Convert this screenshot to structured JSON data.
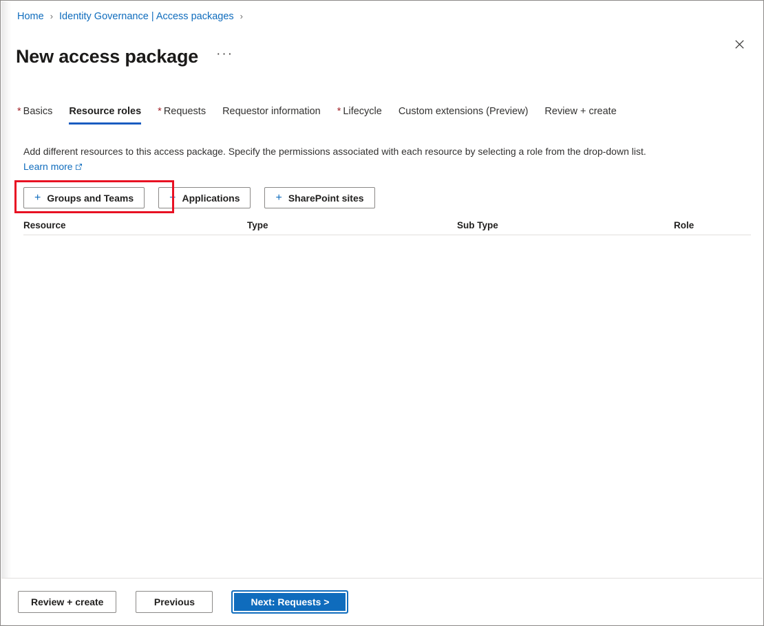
{
  "breadcrumb": {
    "items": [
      {
        "label": "Home",
        "link": true
      },
      {
        "label": "Identity Governance | Access packages",
        "link": true
      }
    ],
    "separator": "›"
  },
  "header": {
    "title": "New access package",
    "ellipsis": "···",
    "close_label": "Close",
    "close_icon": "close-icon"
  },
  "tabs": [
    {
      "label": "Basics",
      "required": true,
      "active": false,
      "required_mark": "*"
    },
    {
      "label": "Resource roles",
      "required": false,
      "active": true,
      "required_mark": "*"
    },
    {
      "label": "Requests",
      "required": true,
      "active": false,
      "required_mark": "*"
    },
    {
      "label": "Requestor information",
      "required": false,
      "active": false,
      "required_mark": "*"
    },
    {
      "label": "Lifecycle",
      "required": true,
      "active": false,
      "required_mark": "*"
    },
    {
      "label": "Custom extensions (Preview)",
      "required": false,
      "active": false,
      "required_mark": "*"
    },
    {
      "label": "Review + create",
      "required": false,
      "active": false,
      "required_mark": "*"
    }
  ],
  "description": {
    "text": "Add different resources to this access package. Specify the permissions associated with each resource by selecting a role from the drop-down list.",
    "link_label": "Learn more",
    "link_icon": "external-link-icon"
  },
  "resource_buttons": [
    {
      "label": "Groups and Teams",
      "icon": "plus-icon",
      "highlighted": true
    },
    {
      "label": "Applications",
      "icon": "plus-icon",
      "highlighted": false
    },
    {
      "label": "SharePoint sites",
      "icon": "plus-icon",
      "highlighted": false
    }
  ],
  "table": {
    "columns": [
      {
        "key": "resource",
        "label": "Resource"
      },
      {
        "key": "type",
        "label": "Type"
      },
      {
        "key": "sub_type",
        "label": "Sub Type"
      },
      {
        "key": "role",
        "label": "Role"
      }
    ],
    "rows": []
  },
  "footer": {
    "buttons": [
      {
        "label": "Review + create",
        "primary": false
      },
      {
        "label": "Previous",
        "primary": false
      },
      {
        "label": "Next: Requests >",
        "primary": true
      }
    ]
  },
  "colors": {
    "link_blue": "#0f6cbd",
    "tab_underline_blue": "#1a5cc0",
    "primary_button_blue": "#0f6cbd",
    "required_asterisk_red": "#a4262c",
    "annotation_red": "#e81123",
    "text_primary": "#201f1e",
    "border_gray": "#8a8886",
    "divider_gray": "#e1dfdd"
  }
}
